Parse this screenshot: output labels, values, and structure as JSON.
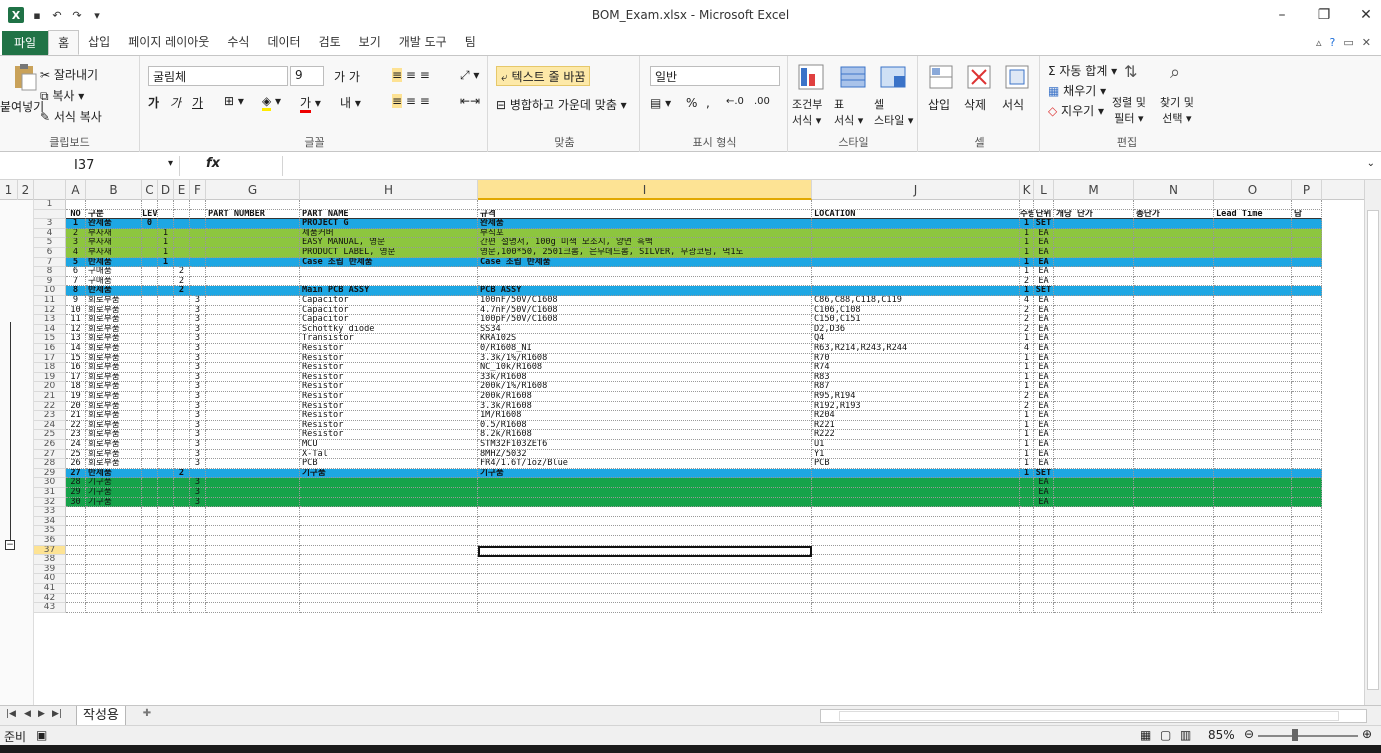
{
  "window": {
    "title": "BOM_Exam.xlsx - Microsoft Excel",
    "logo": "X",
    "quick_access": [
      "save-icon",
      "undo-icon",
      "redo-icon",
      "customize-icon"
    ],
    "controls": {
      "minimize": "–",
      "maximize": "❐",
      "close": "✕"
    }
  },
  "tabs": [
    "파일",
    "홈",
    "삽입",
    "페이지 레이아웃",
    "수식",
    "데이터",
    "검토",
    "보기",
    "개발 도구",
    "팀"
  ],
  "active_tab": "홈",
  "ribbon": {
    "clipboard": {
      "paste": "붙여넣기",
      "cut": "잘라내기",
      "copy": "복사 ▾",
      "format_painter": "서식 복사",
      "label": "클립보드"
    },
    "font": {
      "name": "굴림체",
      "size": "9",
      "label": "글꼴",
      "bold": "가",
      "italic": "가",
      "underline": "가"
    },
    "alignment": {
      "wrap": "텍스트 줄 바꿈",
      "merge": "병합하고 가운데 맞춤 ▾",
      "label": "맞춤"
    },
    "number": {
      "format": "일반",
      "label": "표시 형식",
      "percent": "%",
      "comma": ",",
      "inc": "←.0",
      "dec": ".00"
    },
    "styles": {
      "conditional": "조건부\n서식 ▾",
      "table": "표\n서식 ▾",
      "cell": "셀\n스타일 ▾",
      "label": "스타일"
    },
    "cells": {
      "insert": "삽입",
      "delete": "삭제",
      "format": "서식",
      "label": "셀"
    },
    "editing": {
      "autosum": "Σ 자동 합계 ▾",
      "fill": "채우기 ▾",
      "clear": "지우기 ▾",
      "sort": "정렬 및\n필터 ▾",
      "find": "찾기 및\n선택 ▾",
      "label": "편집"
    }
  },
  "formula_bar": {
    "name_box": "I37",
    "fx": "fx",
    "value": ""
  },
  "columns": [
    "A",
    "B",
    "C",
    "D",
    "E",
    "F",
    "G",
    "H",
    "I",
    "J",
    "K",
    "L",
    "M",
    "N",
    "O",
    "P"
  ],
  "selected_column": "I",
  "outline_levels": [
    "1",
    "2"
  ],
  "header_row": {
    "row_num": "2",
    "cells": [
      "NO",
      "구분",
      "LEVEL",
      "",
      "",
      "",
      "PART NUMBER",
      "PART NAME",
      "규격",
      "LOCATION",
      "수량",
      "단위",
      "개당 단가",
      "총단가",
      "Lead Time",
      "담"
    ]
  },
  "rows": [
    {
      "r": "1",
      "style": "plain",
      "c": [
        "",
        "",
        "",
        "",
        "",
        "",
        "",
        "",
        "",
        "",
        "",
        "",
        "",
        "",
        "",
        ""
      ]
    },
    {
      "r": "3",
      "style": "blue",
      "c": [
        "1",
        "완제품",
        "0",
        "",
        "",
        "",
        "",
        "PROJECT G",
        "완제품",
        "",
        "1",
        "SET",
        "",
        "",
        "",
        ""
      ]
    },
    {
      "r": "4",
      "style": "green",
      "c": [
        "2",
        "부자재",
        "",
        "1",
        "",
        "",
        "",
        "제품커버",
        "부직포",
        "",
        "1",
        "EA",
        "",
        "",
        "",
        ""
      ]
    },
    {
      "r": "5",
      "style": "green",
      "c": [
        "3",
        "부자재",
        "",
        "1",
        "",
        "",
        "",
        "EASY MANUAL, 영문",
        "간편 설명서, 100g 미색 모조지, 양면 흑백",
        "",
        "1",
        "EA",
        "",
        "",
        "",
        ""
      ]
    },
    {
      "r": "6",
      "style": "green",
      "c": [
        "4",
        "부자재",
        "",
        "1",
        "",
        "",
        "",
        "PRODUCT LABEL, 영문",
        "영문,100*50, 2501크롬, 은무데드롬, SILVER, 무광코팅, 먹1도",
        "",
        "1",
        "EA",
        "",
        "",
        "",
        ""
      ]
    },
    {
      "r": "7",
      "style": "blue",
      "c": [
        "5",
        "반제품",
        "",
        "1",
        "",
        "",
        "",
        "Case 조립 반제품",
        "Case 조립 반제품",
        "",
        "1",
        "EA",
        "",
        "",
        "",
        ""
      ]
    },
    {
      "r": "8",
      "style": "plain",
      "c": [
        "6",
        "구매품",
        "",
        "",
        "2",
        "",
        "",
        "",
        "",
        "",
        "1",
        "EA",
        "",
        "",
        "",
        ""
      ]
    },
    {
      "r": "9",
      "style": "plain",
      "c": [
        "7",
        "구매품",
        "",
        "",
        "2",
        "",
        "",
        "",
        "",
        "",
        "2",
        "EA",
        "",
        "",
        "",
        ""
      ]
    },
    {
      "r": "10",
      "style": "blue",
      "c": [
        "8",
        "반제품",
        "",
        "",
        "2",
        "",
        "",
        "Main PCB ASSY",
        "PCB ASSY",
        "",
        "1",
        "SET",
        "",
        "",
        "",
        ""
      ]
    },
    {
      "r": "11",
      "style": "plain",
      "c": [
        "9",
        "회로부품",
        "",
        "",
        "",
        "3",
        "",
        "Capacitor",
        "100nF/50V/C1608",
        "C86,C88,C118,C119",
        "4",
        "EA",
        "",
        "",
        "",
        ""
      ]
    },
    {
      "r": "12",
      "style": "plain",
      "c": [
        "10",
        "회로부품",
        "",
        "",
        "",
        "3",
        "",
        "Capacitor",
        "4.7nF/50V/C1608",
        "C106,C108",
        "2",
        "EA",
        "",
        "",
        "",
        ""
      ]
    },
    {
      "r": "13",
      "style": "plain",
      "c": [
        "11",
        "회로부품",
        "",
        "",
        "",
        "3",
        "",
        "Capacitor",
        "100pF/50V/C1608",
        "C150,C151",
        "2",
        "EA",
        "",
        "",
        "",
        ""
      ]
    },
    {
      "r": "14",
      "style": "plain",
      "c": [
        "12",
        "회로부품",
        "",
        "",
        "",
        "3",
        "",
        "Schottky diode",
        "SS34",
        "D2,D36",
        "2",
        "EA",
        "",
        "",
        "",
        ""
      ]
    },
    {
      "r": "15",
      "style": "plain",
      "c": [
        "13",
        "회로부품",
        "",
        "",
        "",
        "3",
        "",
        "Transistor",
        "KRA102S",
        "Q4",
        "1",
        "EA",
        "",
        "",
        "",
        ""
      ]
    },
    {
      "r": "16",
      "style": "plain",
      "c": [
        "14",
        "회로부품",
        "",
        "",
        "",
        "3",
        "",
        "Resistor",
        "0/R1608_NI",
        "R63,R214,R243,R244",
        "4",
        "EA",
        "",
        "",
        "",
        ""
      ]
    },
    {
      "r": "17",
      "style": "plain",
      "c": [
        "15",
        "회로부품",
        "",
        "",
        "",
        "3",
        "",
        "Resistor",
        "3.3k/1%/R1608",
        "R70",
        "1",
        "EA",
        "",
        "",
        "",
        ""
      ]
    },
    {
      "r": "18",
      "style": "plain",
      "c": [
        "16",
        "회로부품",
        "",
        "",
        "",
        "3",
        "",
        "Resistor",
        "NC_10k/R1608",
        "R74",
        "1",
        "EA",
        "",
        "",
        "",
        ""
      ]
    },
    {
      "r": "19",
      "style": "plain",
      "c": [
        "17",
        "회로부품",
        "",
        "",
        "",
        "3",
        "",
        "Resistor",
        "33k/R1608",
        "R83",
        "1",
        "EA",
        "",
        "",
        "",
        ""
      ]
    },
    {
      "r": "20",
      "style": "plain",
      "c": [
        "18",
        "회로부품",
        "",
        "",
        "",
        "3",
        "",
        "Resistor",
        "200k/1%/R1608",
        "R87",
        "1",
        "EA",
        "",
        "",
        "",
        ""
      ]
    },
    {
      "r": "21",
      "style": "plain",
      "c": [
        "19",
        "회로부품",
        "",
        "",
        "",
        "3",
        "",
        "Resistor",
        "200k/R1608",
        "R95,R194",
        "2",
        "EA",
        "",
        "",
        "",
        ""
      ]
    },
    {
      "r": "22",
      "style": "plain",
      "c": [
        "20",
        "회로부품",
        "",
        "",
        "",
        "3",
        "",
        "Resistor",
        "3.3k/R1608",
        "R192,R193",
        "2",
        "EA",
        "",
        "",
        "",
        ""
      ]
    },
    {
      "r": "23",
      "style": "plain",
      "c": [
        "21",
        "회로부품",
        "",
        "",
        "",
        "3",
        "",
        "Resistor",
        "1M/R1608",
        "R204",
        "1",
        "EA",
        "",
        "",
        "",
        ""
      ]
    },
    {
      "r": "24",
      "style": "plain",
      "c": [
        "22",
        "회로부품",
        "",
        "",
        "",
        "3",
        "",
        "Resistor",
        "0.5/R1608",
        "R221",
        "1",
        "EA",
        "",
        "",
        "",
        ""
      ]
    },
    {
      "r": "25",
      "style": "plain",
      "c": [
        "23",
        "회로부품",
        "",
        "",
        "",
        "3",
        "",
        "Resistor",
        "8.2k/R1608",
        "R222",
        "1",
        "EA",
        "",
        "",
        "",
        ""
      ]
    },
    {
      "r": "26",
      "style": "plain",
      "c": [
        "24",
        "회로부품",
        "",
        "",
        "",
        "3",
        "",
        "MCU",
        "STM32F103ZET6",
        "U1",
        "1",
        "EA",
        "",
        "",
        "",
        ""
      ]
    },
    {
      "r": "27",
      "style": "plain",
      "c": [
        "25",
        "회로부품",
        "",
        "",
        "",
        "3",
        "",
        "X-Tal",
        "8MHZ/5032",
        "Y1",
        "1",
        "EA",
        "",
        "",
        "",
        ""
      ]
    },
    {
      "r": "28",
      "style": "plain",
      "c": [
        "26",
        "회로부품",
        "",
        "",
        "",
        "3",
        "",
        "PCB",
        "FR4/1.6T/1oz/Blue",
        "PCB",
        "1",
        "EA",
        "",
        "",
        "",
        ""
      ]
    },
    {
      "r": "29",
      "style": "blue",
      "c": [
        "27",
        "반제품",
        "",
        "",
        "2",
        "",
        "",
        "기구품",
        "기구품",
        "",
        "1",
        "SET",
        "",
        "",
        "",
        ""
      ]
    },
    {
      "r": "30",
      "style": "dgreen",
      "c": [
        "28",
        "기구품",
        "",
        "",
        "",
        "3",
        "",
        "",
        "",
        "",
        "",
        "EA",
        "",
        "",
        "",
        ""
      ]
    },
    {
      "r": "31",
      "style": "dgreen",
      "c": [
        "29",
        "기구품",
        "",
        "",
        "",
        "3",
        "",
        "",
        "",
        "",
        "",
        "EA",
        "",
        "",
        "",
        ""
      ]
    },
    {
      "r": "32",
      "style": "dgreen",
      "c": [
        "30",
        "기구품",
        "",
        "",
        "",
        "3",
        "",
        "",
        "",
        "",
        "",
        "EA",
        "",
        "",
        "",
        ""
      ]
    },
    {
      "r": "33",
      "style": "plain",
      "c": [
        "",
        "",
        "",
        "",
        "",
        "",
        "",
        "",
        "",
        "",
        "",
        "",
        "",
        "",
        "",
        ""
      ]
    },
    {
      "r": "34",
      "style": "plain",
      "c": [
        "",
        "",
        "",
        "",
        "",
        "",
        "",
        "",
        "",
        "",
        "",
        "",
        "",
        "",
        "",
        ""
      ]
    },
    {
      "r": "35",
      "style": "plain",
      "c": [
        "",
        "",
        "",
        "",
        "",
        "",
        "",
        "",
        "",
        "",
        "",
        "",
        "",
        "",
        "",
        ""
      ]
    },
    {
      "r": "36",
      "style": "plain",
      "c": [
        "",
        "",
        "",
        "",
        "",
        "",
        "",
        "",
        "",
        "",
        "",
        "",
        "",
        "",
        "",
        ""
      ]
    },
    {
      "r": "37",
      "style": "plain",
      "c": [
        "",
        "",
        "",
        "",
        "",
        "",
        "",
        "",
        "",
        "",
        "",
        "",
        "",
        "",
        "",
        ""
      ]
    },
    {
      "r": "38",
      "style": "plain",
      "c": [
        "",
        "",
        "",
        "",
        "",
        "",
        "",
        "",
        "",
        "",
        "",
        "",
        "",
        "",
        "",
        ""
      ]
    },
    {
      "r": "39",
      "style": "plain",
      "c": [
        "",
        "",
        "",
        "",
        "",
        "",
        "",
        "",
        "",
        "",
        "",
        "",
        "",
        "",
        "",
        ""
      ]
    },
    {
      "r": "40",
      "style": "plain",
      "c": [
        "",
        "",
        "",
        "",
        "",
        "",
        "",
        "",
        "",
        "",
        "",
        "",
        "",
        "",
        "",
        ""
      ]
    },
    {
      "r": "41",
      "style": "plain",
      "c": [
        "",
        "",
        "",
        "",
        "",
        "",
        "",
        "",
        "",
        "",
        "",
        "",
        "",
        "",
        "",
        ""
      ]
    },
    {
      "r": "42",
      "style": "plain",
      "c": [
        "",
        "",
        "",
        "",
        "",
        "",
        "",
        "",
        "",
        "",
        "",
        "",
        "",
        "",
        "",
        ""
      ]
    },
    {
      "r": "43",
      "style": "plain",
      "c": [
        "",
        "",
        "",
        "",
        "",
        "",
        "",
        "",
        "",
        "",
        "",
        "",
        "",
        "",
        "",
        ""
      ]
    }
  ],
  "sheet": {
    "name": "작성용",
    "new_sheet_icon": "new-sheet-icon"
  },
  "status": {
    "ready": "준비",
    "zoom": "85%"
  }
}
